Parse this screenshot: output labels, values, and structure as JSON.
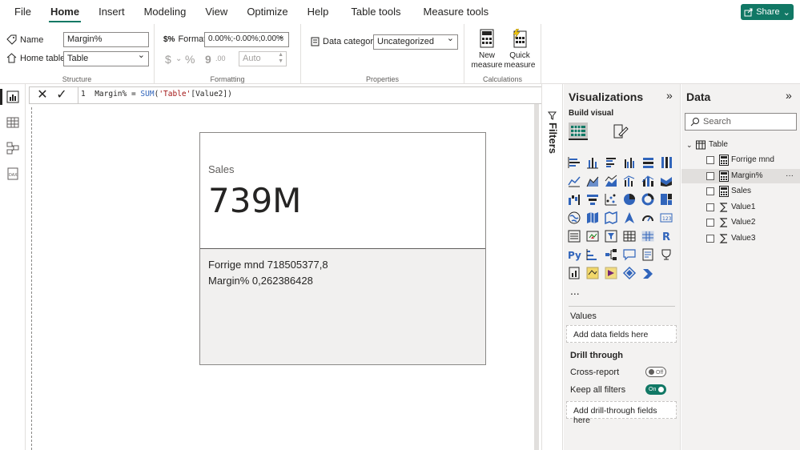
{
  "menu": {
    "items": [
      "File",
      "Home",
      "Insert",
      "Modeling",
      "View",
      "Optimize",
      "Help",
      "Table tools",
      "Measure tools"
    ],
    "active": "Home",
    "share_label": "Share"
  },
  "ribbon": {
    "structure": {
      "name_label": "Name",
      "name_value": "Margin%",
      "home_table_label": "Home table",
      "home_table_value": "Table",
      "group_label": "Structure"
    },
    "formatting": {
      "format_label": "Format",
      "format_value": "0.00%;-0.00%;0.00%",
      "currency_symbol": "$",
      "percent_symbol": "%",
      "comma_symbol": "9",
      "decimal_symbol": ".00",
      "decimals_value": "Auto",
      "group_label": "Formatting"
    },
    "properties": {
      "data_category_label": "Data category",
      "data_category_value": "Uncategorized",
      "group_label": "Properties"
    },
    "calculations": {
      "new_measure_line1": "New",
      "new_measure_line2": "measure",
      "quick_measure_line1": "Quick",
      "quick_measure_line2": "measure",
      "group_label": "Calculations"
    }
  },
  "formula": {
    "line_number": "1",
    "measure": "Margin%",
    "equals": " = ",
    "function": "SUM",
    "open": "(",
    "table_ref": "'Table'",
    "column_ref": "[Value2]",
    "close": ")"
  },
  "card": {
    "title": "Sales",
    "value": "739M",
    "line1": "Forrige mnd 718505377,8",
    "line2": "Margin% 0,262386428"
  },
  "filters": {
    "label": "Filters"
  },
  "visualizations": {
    "title": "Visualizations",
    "build_label": "Build visual",
    "more": "...",
    "values_label": "Values",
    "values_placeholder": "Add data fields here",
    "drillthrough_label": "Drill through",
    "cross_report_label": "Cross-report",
    "cross_report_state": "Off",
    "keep_filters_label": "Keep all filters",
    "keep_filters_state": "On",
    "drillthrough_placeholder": "Add drill-through fields here"
  },
  "data": {
    "title": "Data",
    "search_placeholder": "Search",
    "table_name": "Table",
    "fields": [
      {
        "name": "Forrige mnd",
        "icon": "calculator-icon"
      },
      {
        "name": "Margin%",
        "icon": "calculator-icon"
      },
      {
        "name": "Sales",
        "icon": "calculator-icon"
      },
      {
        "name": "Value1",
        "icon": "sigma-icon"
      },
      {
        "name": "Value2",
        "icon": "sigma-icon"
      },
      {
        "name": "Value3",
        "icon": "sigma-icon"
      }
    ],
    "selected_field": "Margin%",
    "more": "···"
  },
  "colors": {
    "accent": "#117865",
    "pane_bg": "#f3f2f1",
    "card_bottom_bg": "#f1f0ef"
  }
}
